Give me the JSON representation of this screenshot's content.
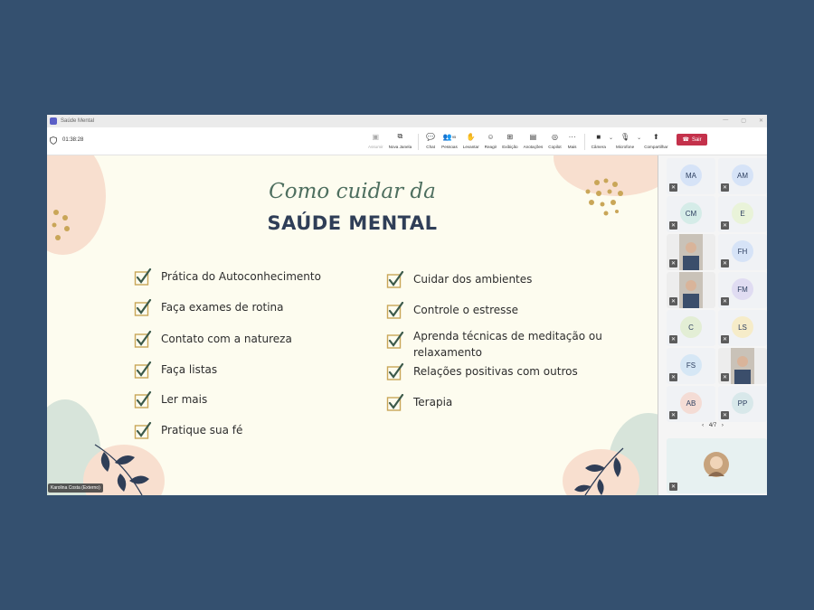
{
  "window": {
    "title": "Saúde Mental"
  },
  "meeting": {
    "timer": "01:38:28"
  },
  "toolbar": {
    "tools": [
      {
        "icon": "focus-icon",
        "label": "Assumir"
      },
      {
        "icon": "new-window-icon",
        "label": "Nova Janela"
      },
      {
        "icon": "chat-icon",
        "label": "Chat"
      },
      {
        "icon": "people-icon",
        "label": "Pessoas",
        "count": "95"
      },
      {
        "icon": "raise-hand-icon",
        "label": "Levantar"
      },
      {
        "icon": "react-icon",
        "label": "Reagir"
      },
      {
        "icon": "view-icon",
        "label": "Exibição"
      },
      {
        "icon": "notes-icon",
        "label": "Anotações"
      },
      {
        "icon": "copilot-icon",
        "label": "Copilot"
      },
      {
        "icon": "more-icon",
        "label": "Mais"
      },
      {
        "icon": "camera-off-icon",
        "label": "Câmera"
      },
      {
        "icon": "mic-off-icon",
        "label": "Microfone"
      },
      {
        "icon": "share-icon",
        "label": "Compartilhar"
      }
    ],
    "leave_label": "Sair"
  },
  "slide": {
    "title_script": "Como cuidar da",
    "title_main": "SAÚDE MENTAL",
    "left_items": [
      "Prática do Autoconhecimento",
      "Faça exames de rotina",
      "Contato com a natureza",
      "Faça listas",
      "Ler mais",
      "Pratique sua fé"
    ],
    "right_items": [
      "Cuidar dos ambientes",
      "Controle o estresse",
      "Aprenda técnicas de meditação ou relaxamento",
      "Relações positivas com outros",
      "Terapia"
    ],
    "presenter_caption": "Karolina Costa (Externo)"
  },
  "participants": [
    {
      "initials": "MA",
      "color": "#d6e3f7"
    },
    {
      "initials": "AM",
      "color": "#d6e3f7"
    },
    {
      "initials": "CM",
      "color": "#d5ece8"
    },
    {
      "initials": "E",
      "color": "#e9f3d9"
    },
    {
      "initials": "",
      "color": "#ededed",
      "video": true
    },
    {
      "initials": "FH",
      "color": "#d6e3f7"
    },
    {
      "initials": "",
      "color": "#ededed",
      "video": true
    },
    {
      "initials": "FM",
      "color": "#e0dcf2"
    },
    {
      "initials": "C",
      "color": "#e3eed5"
    },
    {
      "initials": "LS",
      "color": "#f6ecc9"
    },
    {
      "initials": "FS",
      "color": "#d6e7f5"
    },
    {
      "initials": "",
      "color": "#ededed",
      "video": true
    },
    {
      "initials": "AB",
      "color": "#f4dcd5"
    },
    {
      "initials": "PP",
      "color": "#d8e8ea"
    }
  ],
  "pager": {
    "label": "4/7"
  }
}
